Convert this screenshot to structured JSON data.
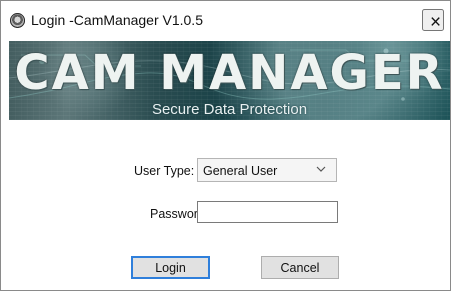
{
  "window": {
    "title": "Login -CamManager V1.0.5",
    "close_symbol": "×"
  },
  "banner": {
    "title": "CAM MANAGER",
    "subtitle": "Secure Data Protection"
  },
  "form": {
    "user_type_label": "User Type:",
    "user_type_value": "General User",
    "password_label": "Password:",
    "password_value": ""
  },
  "buttons": {
    "login": "Login",
    "cancel": "Cancel"
  },
  "icons": {
    "app": "camera-lens-icon",
    "close": "close-icon",
    "dropdown": "chevron-down-icon"
  },
  "colors": {
    "banner_accent": "#0c3b42",
    "focus_border": "#2f7fdb",
    "button_bg": "#e1e1e1"
  }
}
